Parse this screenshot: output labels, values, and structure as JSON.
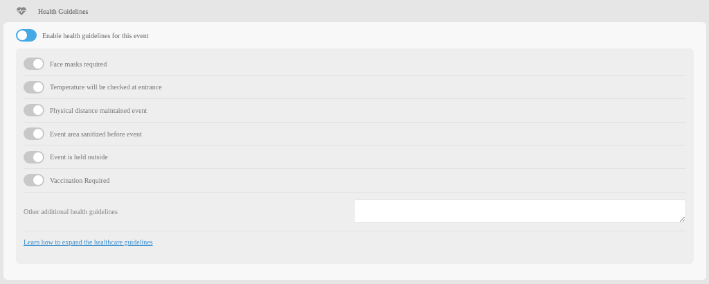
{
  "header": {
    "title": "Health Guidelines"
  },
  "main_toggle": {
    "label": "Enable health guidelines for this event",
    "on": false,
    "color": "#45a9e6"
  },
  "guidelines": [
    {
      "label": "Face masks required",
      "on": true,
      "disabled": true
    },
    {
      "label": "Temperature will be checked at entrance",
      "on": true,
      "disabled": true
    },
    {
      "label": "Physical distance maintained event",
      "on": true,
      "disabled": true
    },
    {
      "label": "Event area sanitized before event",
      "on": true,
      "disabled": true
    },
    {
      "label": "Event is held outside",
      "on": true,
      "disabled": true
    },
    {
      "label": "Vaccination Required",
      "on": true,
      "disabled": true
    }
  ],
  "other": {
    "label": "Other additional health guidelines"
  },
  "link": "Learn how to expand the healthcare guidelines"
}
